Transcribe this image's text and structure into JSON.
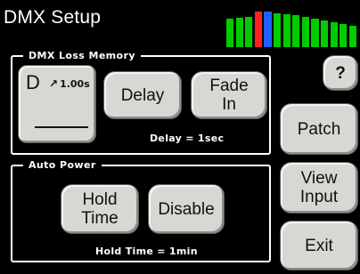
{
  "header": {
    "title": "DMX Setup"
  },
  "meter": {
    "bars": [
      {
        "color": "#00cc00",
        "level": 0.8
      },
      {
        "color": "#00cc00",
        "level": 0.83
      },
      {
        "color": "#00cc00",
        "level": 0.86
      },
      {
        "color": "#ff2020",
        "level": 1.0
      },
      {
        "color": "#2060ff",
        "level": 1.0
      },
      {
        "color": "#00cc00",
        "level": 0.95
      },
      {
        "color": "#00cc00",
        "level": 0.93
      },
      {
        "color": "#00cc00",
        "level": 0.9
      },
      {
        "color": "#00cc00",
        "level": 0.85
      },
      {
        "color": "#00cc00",
        "level": 0.8
      },
      {
        "color": "#00cc00",
        "level": 0.75
      },
      {
        "color": "#00cc00",
        "level": 0.7
      },
      {
        "color": "#00cc00",
        "level": 0.65
      },
      {
        "color": "#00cc00",
        "level": 0.6
      }
    ]
  },
  "loss_memory": {
    "label": "DMX Loss Memory",
    "mode_letter": "D",
    "mode_arrow": "↗",
    "mode_rate": "1.00s",
    "delay_label": "Delay",
    "fade_in_line1": "Fade",
    "fade_in_line2": "In",
    "status": "Delay = 1sec"
  },
  "auto_power": {
    "label": "Auto Power",
    "hold_time_line1": "Hold",
    "hold_time_line2": "Time",
    "disable_label": "Disable",
    "status": "Hold Time = 1min"
  },
  "side_buttons": {
    "help": "?",
    "patch": "Patch",
    "view_input_line1": "View",
    "view_input_line2": "Input",
    "exit": "Exit"
  }
}
